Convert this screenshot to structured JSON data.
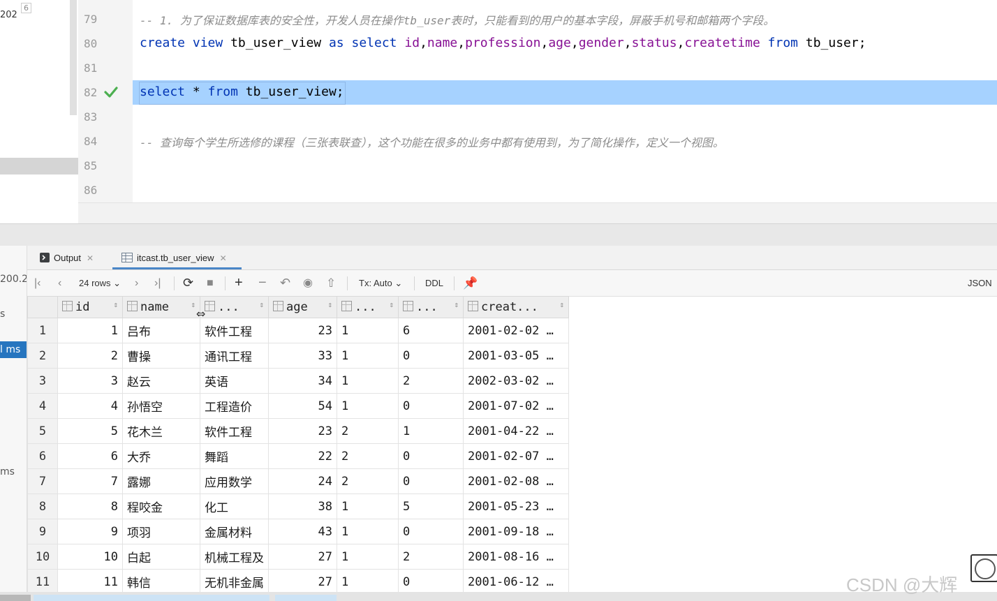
{
  "left_strip": {
    "tab_label": "202",
    "tab_badge": "6"
  },
  "editor": {
    "line_numbers": [
      "79",
      "80",
      "81",
      "82",
      "83",
      "84",
      "85",
      "86"
    ],
    "line79_comment": "-- 1. 为了保证数据库表的安全性，开发人员在操作tb_user表时，只能看到的用户的基本字段，屏蔽手机号和邮箱两个字段。",
    "line80": {
      "kw_create": "create",
      "kw_view": "view",
      "name": "tb_user_view",
      "kw_as": "as",
      "kw_select": "select",
      "f_id": "id",
      "f_name": "name",
      "f_profession": "profession",
      "f_age": "age",
      "f_gender": "gender",
      "f_status": "status",
      "f_createtime": "createtime",
      "kw_from": "from",
      "table": "tb_user;"
    },
    "line82": {
      "kw_select": "select",
      "star": "*",
      "kw_from": "from",
      "table": "tb_user_view;"
    },
    "line84_comment": "-- 查询每个学生所选修的课程（三张表联查），这个功能在很多的业务中都有使用到，为了简化操作，定义一个视图。"
  },
  "services": {
    "t1": "200.2(",
    "t2": "s",
    "t3": "l ms",
    "t4": "ms"
  },
  "tabs": [
    {
      "label": "Output",
      "icon": "console-icon"
    },
    {
      "label": "itcast.tb_user_view",
      "icon": "table-icon"
    }
  ],
  "toolbar": {
    "rows": "24 rows",
    "tx": "Tx: Auto",
    "ddl": "DDL",
    "json": "JSON"
  },
  "grid": {
    "headers": [
      "id",
      "name",
      "...",
      "age",
      "...",
      "...",
      "creat..."
    ],
    "rows": [
      [
        "1",
        "1",
        "吕布",
        "软件工程",
        "23",
        "1",
        "6",
        "2001-02-02 …"
      ],
      [
        "2",
        "2",
        "曹操",
        "通讯工程",
        "33",
        "1",
        "0",
        "2001-03-05 …"
      ],
      [
        "3",
        "3",
        "赵云",
        "英语",
        "34",
        "1",
        "2",
        "2002-03-02 …"
      ],
      [
        "4",
        "4",
        "孙悟空",
        "工程造价",
        "54",
        "1",
        "0",
        "2001-07-02 …"
      ],
      [
        "5",
        "5",
        "花木兰",
        "软件工程",
        "23",
        "2",
        "1",
        "2001-04-22 …"
      ],
      [
        "6",
        "6",
        "大乔",
        "舞蹈",
        "22",
        "2",
        "0",
        "2001-02-07 …"
      ],
      [
        "7",
        "7",
        "露娜",
        "应用数学",
        "24",
        "2",
        "0",
        "2001-02-08 …"
      ],
      [
        "8",
        "8",
        "程咬金",
        "化工",
        "38",
        "1",
        "5",
        "2001-05-23 …"
      ],
      [
        "9",
        "9",
        "项羽",
        "金属材料",
        "43",
        "1",
        "0",
        "2001-09-18 …"
      ],
      [
        "10",
        "10",
        "白起",
        "机械工程及",
        "27",
        "1",
        "2",
        "2001-08-16 …"
      ],
      [
        "11",
        "11",
        "韩信",
        "无机非金属",
        "27",
        "1",
        "0",
        "2001-06-12 …"
      ]
    ]
  },
  "watermark": "CSDN @大辉"
}
